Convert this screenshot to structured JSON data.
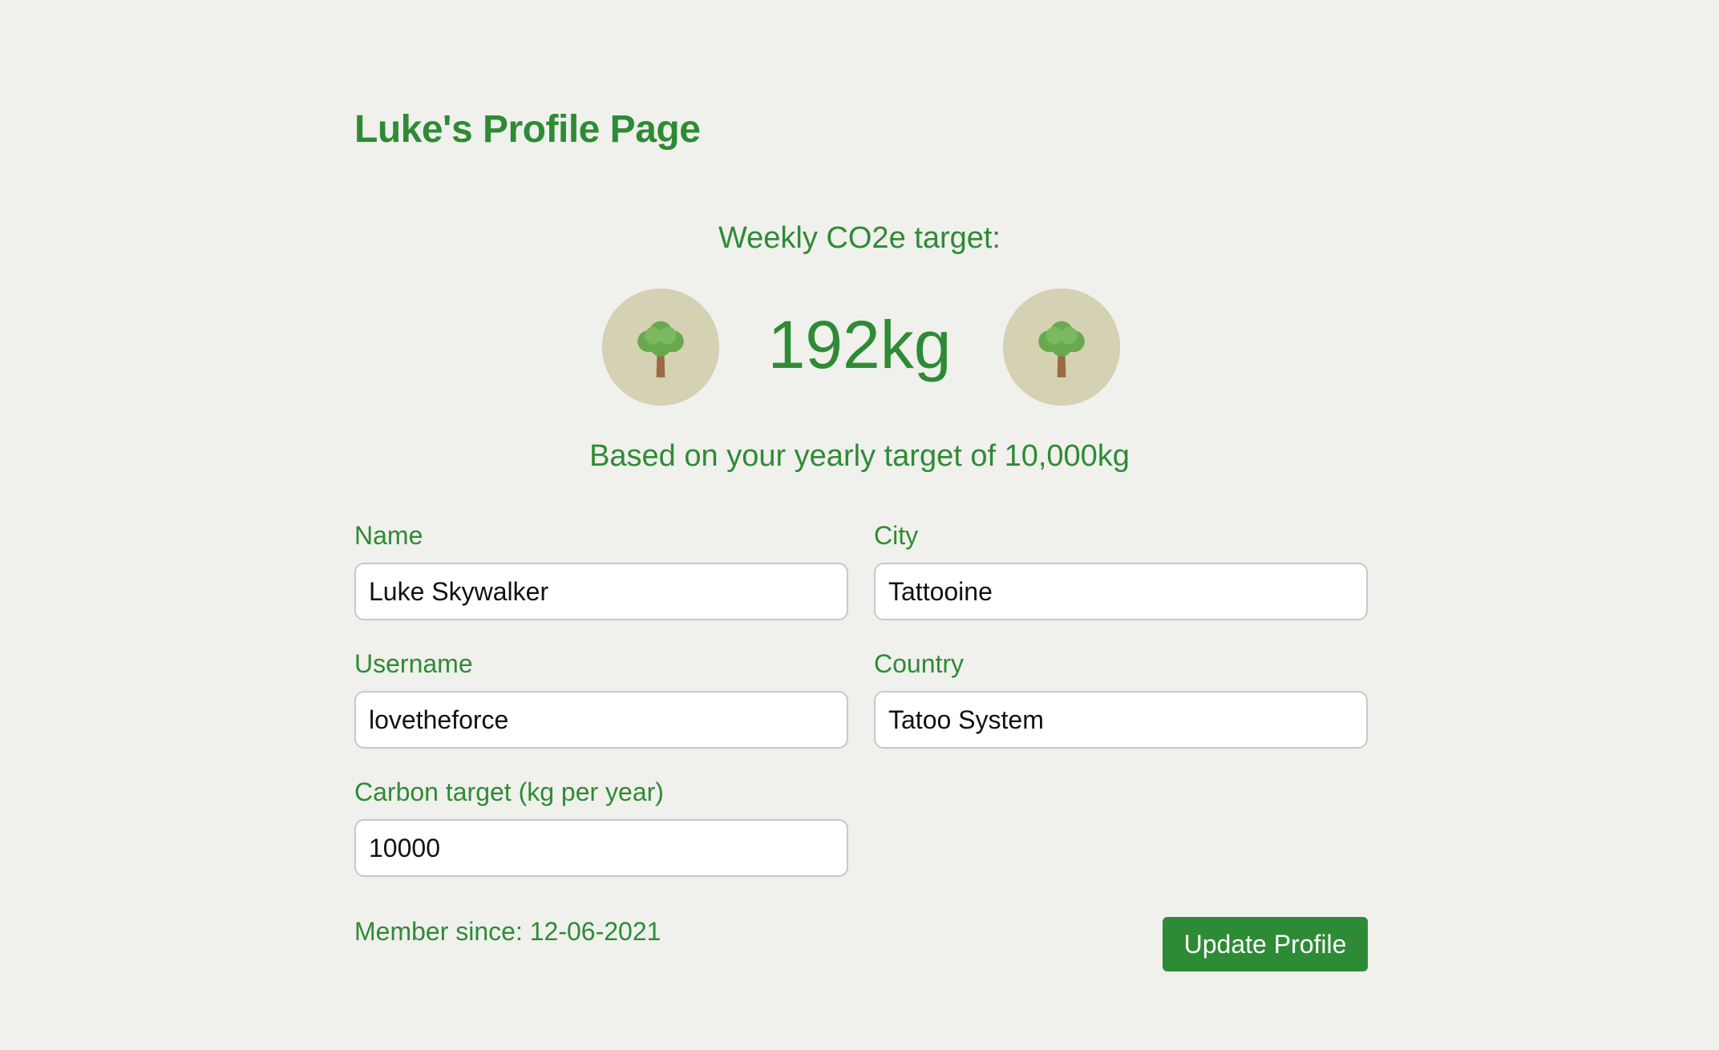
{
  "page": {
    "title": "Luke's Profile Page"
  },
  "target": {
    "heading": "Weekly CO2e target:",
    "value": "192kg",
    "subtext": "Based on your yearly target of 10,000kg",
    "icon": "tree-icon"
  },
  "form": {
    "name": {
      "label": "Name",
      "value": "Luke Skywalker"
    },
    "city": {
      "label": "City",
      "value": "Tattooine"
    },
    "username": {
      "label": "Username",
      "value": "lovetheforce"
    },
    "country": {
      "label": "Country",
      "value": "Tatoo System"
    },
    "carbon_target": {
      "label": "Carbon target (kg per year)",
      "value": "10000"
    }
  },
  "footer": {
    "member_since": "Member since: 12-06-2021",
    "update_label": "Update Profile"
  },
  "colors": {
    "background": "#f0f0ec",
    "accent": "#2e8b35",
    "badge": "#d5d2b4"
  }
}
